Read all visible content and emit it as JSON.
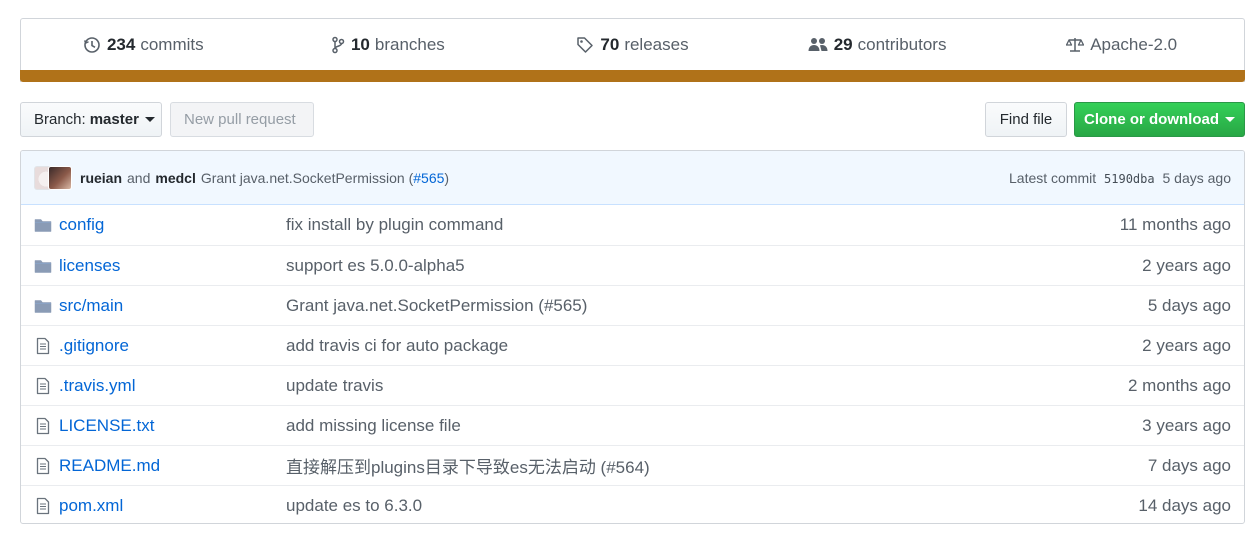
{
  "summary": {
    "commits": {
      "num": "234",
      "label": "commits",
      "icon": "history-icon"
    },
    "branches": {
      "num": "10",
      "label": "branches",
      "icon": "branch-icon"
    },
    "releases": {
      "num": "70",
      "label": "releases",
      "icon": "tag-icon"
    },
    "contributors": {
      "num": "29",
      "label": "contributors",
      "icon": "people-icon"
    },
    "license": {
      "label": "Apache-2.0",
      "icon": "law-icon"
    }
  },
  "colors": {
    "language_bar": "#b07219",
    "link": "#0366d6",
    "clone_button": "#28a745"
  },
  "actions": {
    "branch_prefix": "Branch:",
    "branch_name": "master",
    "new_pull_request": "New pull request",
    "find_file": "Find file",
    "clone_or_download": "Clone or download"
  },
  "latest_commit": {
    "author1": "rueian",
    "and": "and",
    "author2": "medcl",
    "message": "Grant java.net.SocketPermission (",
    "pr_link": "#565",
    "message_end": ")",
    "label": "Latest commit",
    "sha": "5190dba",
    "age": "5 days ago"
  },
  "files": [
    {
      "type": "directory",
      "name": "config",
      "message": "fix install by plugin command",
      "age": "11 months ago"
    },
    {
      "type": "directory",
      "name": "licenses",
      "message": "support es 5.0.0-alpha5",
      "age": "2 years ago"
    },
    {
      "type": "directory",
      "name": "src/main",
      "message": "Grant java.net.SocketPermission (#565)",
      "age": "5 days ago"
    },
    {
      "type": "file",
      "name": ".gitignore",
      "message": "add travis ci for auto package",
      "age": "2 years ago"
    },
    {
      "type": "file",
      "name": ".travis.yml",
      "message": "update travis",
      "age": "2 months ago"
    },
    {
      "type": "file",
      "name": "LICENSE.txt",
      "message": "add missing license file",
      "age": "3 years ago"
    },
    {
      "type": "file",
      "name": "README.md",
      "message": "直接解压到plugins目录下导致es无法启动 (#564)",
      "age": "7 days ago"
    },
    {
      "type": "file",
      "name": "pom.xml",
      "message": "update es to 6.3.0",
      "age": "14 days ago"
    }
  ]
}
